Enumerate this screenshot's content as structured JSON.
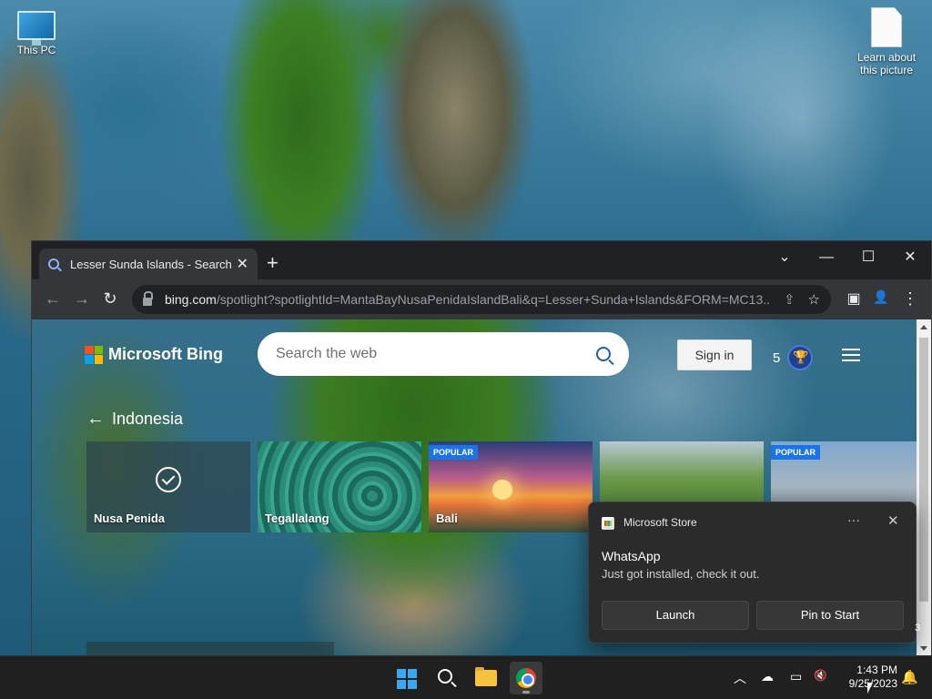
{
  "desktop": {
    "icons": [
      {
        "label": "This PC"
      },
      {
        "label": "Learn about this picture"
      }
    ]
  },
  "browser": {
    "tab": {
      "title": "Lesser Sunda Islands - Search",
      "close": "✕"
    },
    "new_tab": "+",
    "window_controls": {
      "dropdown": "⌄",
      "minimize": "—",
      "maximize": "☐",
      "close": "✕"
    },
    "toolbar": {
      "back": "←",
      "forward": "→",
      "reload": "↻"
    },
    "address": {
      "host": "bing.com",
      "path": "/spotlight?spotlightId=MantaBayNusaPenidaIslandBali&q=Lesser+Sunda+Islands&FORM=MC13..."
    },
    "omni_icons": {
      "share": "⇪",
      "bookmark": "☆",
      "sidepanel": "▣",
      "profile": "👤",
      "menu": "⋮"
    }
  },
  "bing": {
    "logo_text": "Microsoft Bing",
    "search_placeholder": "Search the web",
    "sign_in": "Sign in",
    "rewards_count": "5",
    "section_title": "Indonesia",
    "cards": [
      {
        "label": "Nusa Penida",
        "badge": "",
        "selected": true
      },
      {
        "label": "Tegallalang",
        "badge": ""
      },
      {
        "label": "Bali",
        "badge": "POPULAR"
      },
      {
        "label": "",
        "badge": ""
      },
      {
        "label": "",
        "badge": "POPULAR"
      }
    ]
  },
  "toast": {
    "app_name": "Microsoft Store",
    "more": "···",
    "close": "✕",
    "title": "WhatsApp",
    "body": "Just got installed, check it out.",
    "buttons": {
      "launch": "Launch",
      "pin": "Pin to Start"
    }
  },
  "stray_number": "3",
  "taskbar": {
    "tray": {
      "chevron": "︿",
      "onedrive": "☁",
      "display": "▭",
      "sound": "🔇"
    },
    "clock": {
      "time": "1:43 PM",
      "date": "9/25/2023"
    },
    "bell": "🔔"
  }
}
